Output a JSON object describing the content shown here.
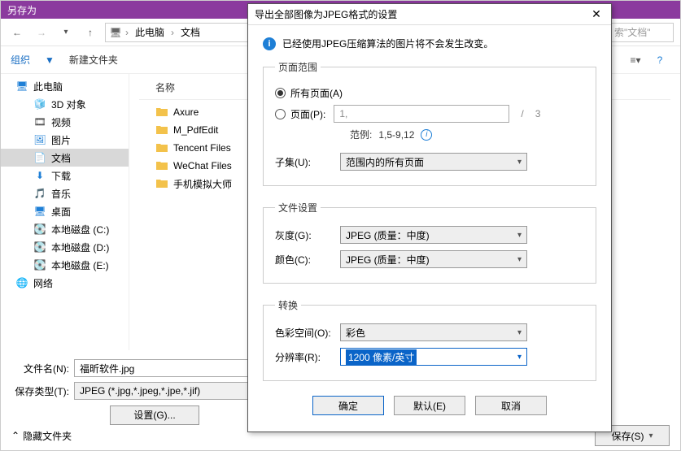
{
  "window": {
    "title": "另存为"
  },
  "nav": {
    "breadcrumb": [
      "此电脑",
      "文档"
    ],
    "search_placeholder": "索\"文档\""
  },
  "toolbar": {
    "organize": "组织",
    "new_folder": "新建文件夹"
  },
  "sidebar": {
    "items": [
      {
        "label": "此电脑",
        "icon": "pc",
        "indent": false
      },
      {
        "label": "3D 对象",
        "icon": "3d",
        "indent": true
      },
      {
        "label": "视频",
        "icon": "video",
        "indent": true
      },
      {
        "label": "图片",
        "icon": "pic",
        "indent": true
      },
      {
        "label": "文档",
        "icon": "doc",
        "indent": true,
        "selected": true
      },
      {
        "label": "下载",
        "icon": "dl",
        "indent": true
      },
      {
        "label": "音乐",
        "icon": "music",
        "indent": true
      },
      {
        "label": "桌面",
        "icon": "desktop",
        "indent": true
      },
      {
        "label": "本地磁盘 (C:)",
        "icon": "disk",
        "indent": true
      },
      {
        "label": "本地磁盘 (D:)",
        "icon": "disk",
        "indent": true
      },
      {
        "label": "本地磁盘 (E:)",
        "icon": "disk",
        "indent": true
      },
      {
        "label": "网络",
        "icon": "net",
        "indent": false
      }
    ]
  },
  "filelist": {
    "header": "名称",
    "items": [
      "Axure",
      "M_PdfEdit",
      "Tencent Files",
      "WeChat Files",
      "手机模拟大师"
    ]
  },
  "form": {
    "filename_label": "文件名(N):",
    "filename_value": "福昕软件.jpg",
    "type_label": "保存类型(T):",
    "type_value": "JPEG (*.jpg,*.jpeg,*.jpe,*.jif)",
    "settings_btn": "设置(G)..."
  },
  "footer": {
    "hide_folders": "隐藏文件夹",
    "save": "保存(S)"
  },
  "dialog": {
    "title": "导出全部图像为JPEG格式的设置",
    "info": "已经使用JPEG压缩算法的图片将不会发生改变。",
    "page_range": {
      "legend": "页面范围",
      "all": "所有页面(A)",
      "pages": "页面(P):",
      "pages_value": "1,",
      "total": "3",
      "example_label": "范例:",
      "example_value": "1,5-9,12",
      "subset_label": "子集(U):",
      "subset_value": "范围内的所有页面"
    },
    "file_settings": {
      "legend": "文件设置",
      "gray_label": "灰度(G):",
      "gray_value": "JPEG (质量：中度)",
      "color_label": "颜色(C):",
      "color_value": "JPEG (质量：中度)"
    },
    "convert": {
      "legend": "转换",
      "colorspace_label": "色彩空间(O):",
      "colorspace_value": "彩色",
      "resolution_label": "分辨率(R):",
      "resolution_value": "1200 像素/英寸"
    },
    "buttons": {
      "ok": "确定",
      "default": "默认(E)",
      "cancel": "取消"
    }
  }
}
